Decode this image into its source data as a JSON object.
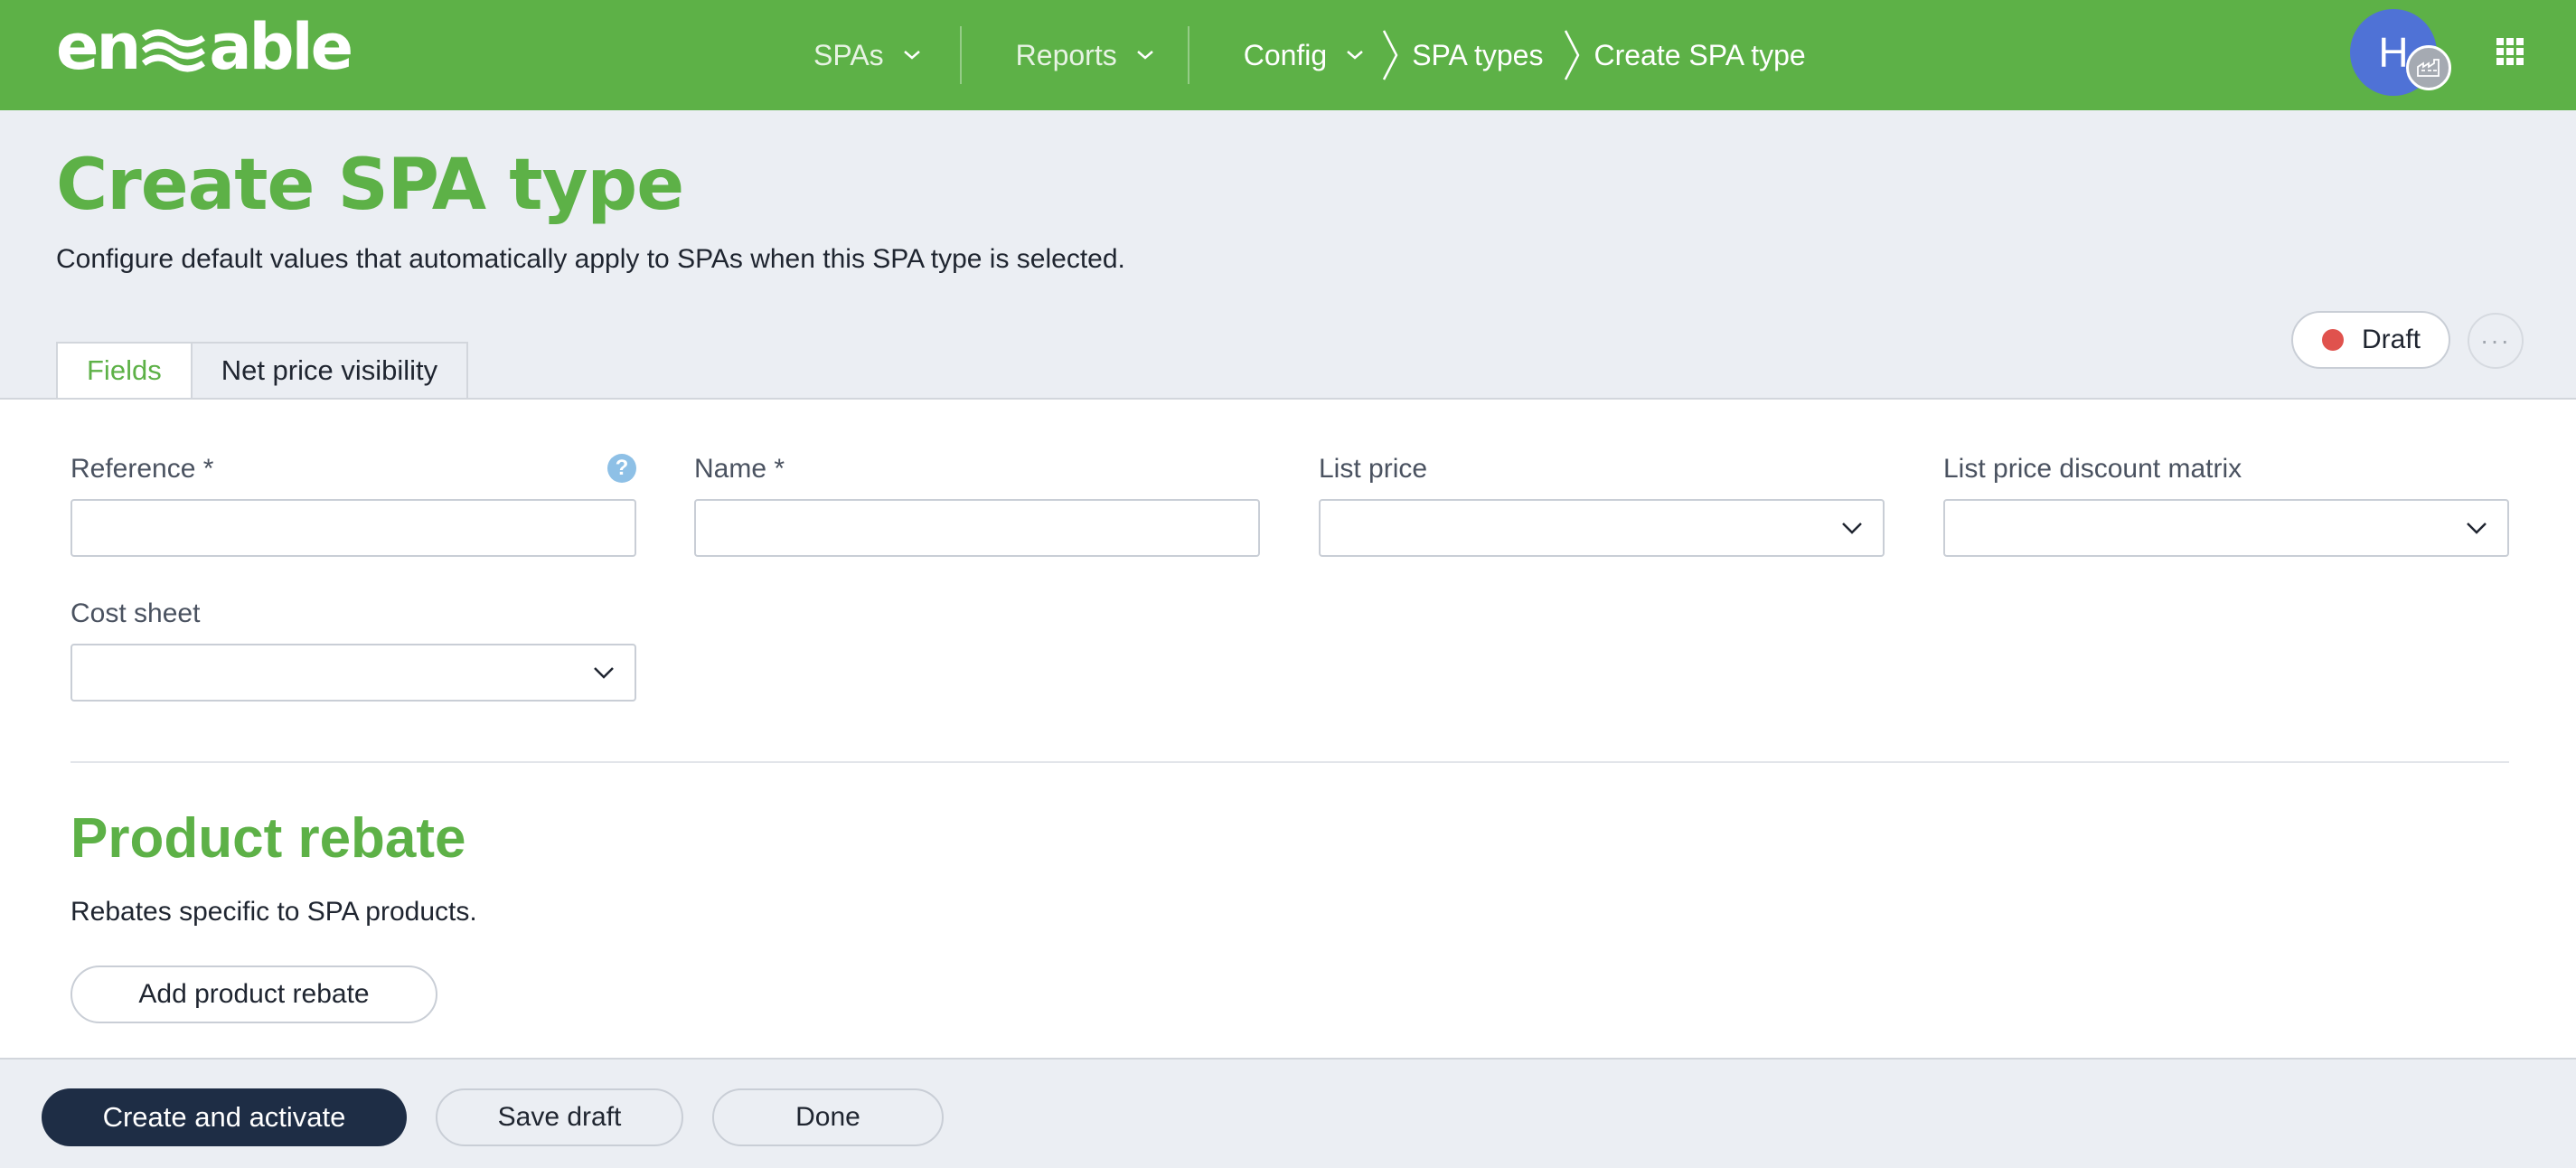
{
  "header": {
    "logo_text": "enable",
    "nav": {
      "spas": "SPAs",
      "reports": "Reports",
      "config": "Config",
      "spa_types": "SPA types",
      "current": "Create SPA type"
    },
    "avatar_initial": "H"
  },
  "page": {
    "title": "Create SPA type",
    "subtitle": "Configure default values that automatically apply to SPAs when this SPA type is selected.",
    "status": "Draft",
    "more": "···"
  },
  "tabs": [
    {
      "label": "Fields",
      "active": true
    },
    {
      "label": "Net price visibility",
      "active": false
    }
  ],
  "fields": {
    "reference": {
      "label": "Reference *",
      "value": ""
    },
    "name": {
      "label": "Name *",
      "value": ""
    },
    "list_price": {
      "label": "List price",
      "value": ""
    },
    "list_price_discount_matrix": {
      "label": "List price discount matrix",
      "value": ""
    },
    "cost_sheet": {
      "label": "Cost sheet",
      "value": ""
    },
    "help": "?"
  },
  "product_rebate": {
    "title": "Product rebate",
    "description": "Rebates specific to SPA products.",
    "add_button": "Add product rebate"
  },
  "footer": {
    "create_activate": "Create and activate",
    "save_draft": "Save draft",
    "done": "Done"
  },
  "colors": {
    "brand_green": "#5db147",
    "primary_navy": "#1e2d45",
    "draft_red": "#e0524d",
    "help_blue": "#8ec0e6",
    "avatar_blue": "#4f72d6"
  },
  "icons": [
    "chevron-down-icon",
    "breadcrumb-arrow-icon",
    "apps-grid-icon",
    "factory-icon",
    "help-icon",
    "caret-down-icon"
  ]
}
